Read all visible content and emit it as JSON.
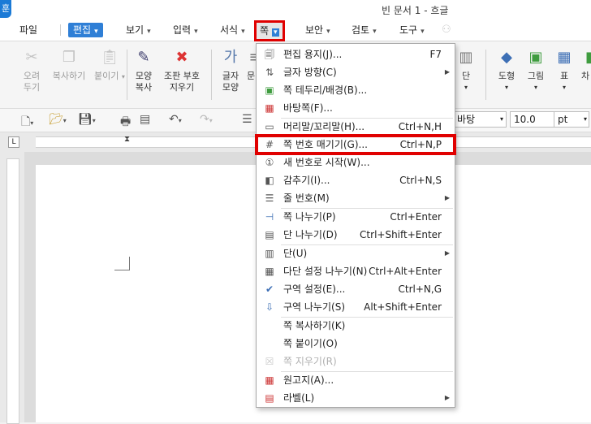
{
  "titlebar": {
    "logo": "훈",
    "title": "빈 문서 1 - 흐글"
  },
  "menubar": {
    "items": [
      {
        "label": "파일"
      },
      {
        "label": "편집"
      },
      {
        "label": "보기"
      },
      {
        "label": "입력"
      },
      {
        "label": "서식"
      },
      {
        "label": "쪽"
      },
      {
        "label": "보안"
      },
      {
        "label": "검토"
      },
      {
        "label": "도구"
      }
    ]
  },
  "ribbon": {
    "cut": "오려\n두기",
    "copy": "복사하기",
    "paste": "붙이기",
    "format_copy": "모양\n복사",
    "mark_remove": "조판 부호\n지우기",
    "char_shape": "글자\n모양",
    "para_shape": "문",
    "column": "단",
    "shape": "도형",
    "picture": "그림",
    "table": "표",
    "chart_partial": "차"
  },
  "toolbar2": {
    "style_name": "바탕",
    "font_size": "10.0",
    "unit": "pt"
  },
  "dropdown": {
    "items": [
      {
        "label": "편집 용지(J)...",
        "shortcut": "F7",
        "icon": "page-setup-icon",
        "submenu": false,
        "disabled": false
      },
      {
        "label": "글자 방향(C)",
        "shortcut": "",
        "icon": "text-direction-icon",
        "submenu": true,
        "disabled": false
      },
      {
        "label": "쪽 테두리/배경(B)...",
        "shortcut": "",
        "icon": "page-border-icon",
        "submenu": false,
        "disabled": false
      },
      {
        "label": "바탕쪽(F)...",
        "shortcut": "",
        "icon": "master-page-icon",
        "submenu": false,
        "disabled": false
      },
      {
        "label": "머리말/꼬리말(H)...",
        "shortcut": "Ctrl+N,H",
        "icon": "header-footer-icon",
        "submenu": false,
        "disabled": false
      },
      {
        "label": "쪽 번호 매기기(G)...",
        "shortcut": "Ctrl+N,P",
        "icon": "page-number-icon",
        "submenu": false,
        "disabled": false
      },
      {
        "label": "새 번호로 시작(W)...",
        "shortcut": "",
        "icon": "new-number-icon",
        "submenu": false,
        "disabled": false
      },
      {
        "label": "감추기(I)...",
        "shortcut": "Ctrl+N,S",
        "icon": "hide-icon",
        "submenu": false,
        "disabled": false
      },
      {
        "label": "줄 번호(M)",
        "shortcut": "",
        "icon": "line-number-icon",
        "submenu": true,
        "disabled": false
      },
      {
        "label": "쪽 나누기(P)",
        "shortcut": "Ctrl+Enter",
        "icon": "page-break-icon",
        "submenu": false,
        "disabled": false
      },
      {
        "label": "단 나누기(D)",
        "shortcut": "Ctrl+Shift+Enter",
        "icon": "column-break-icon",
        "submenu": false,
        "disabled": false
      },
      {
        "label": "단(U)",
        "shortcut": "",
        "icon": "column-icon",
        "submenu": true,
        "disabled": false
      },
      {
        "label": "다단 설정 나누기(N)",
        "shortcut": "Ctrl+Alt+Enter",
        "icon": "multi-column-icon",
        "submenu": false,
        "disabled": false
      },
      {
        "label": "구역 설정(E)...",
        "shortcut": "Ctrl+N,G",
        "icon": "section-setup-icon",
        "submenu": false,
        "disabled": false
      },
      {
        "label": "구역 나누기(S)",
        "shortcut": "Alt+Shift+Enter",
        "icon": "section-break-icon",
        "submenu": false,
        "disabled": false
      },
      {
        "label": "쪽 복사하기(K)",
        "shortcut": "",
        "icon": "",
        "submenu": false,
        "disabled": false
      },
      {
        "label": "쪽 붙이기(O)",
        "shortcut": "",
        "icon": "",
        "submenu": false,
        "disabled": false
      },
      {
        "label": "쪽 지우기(R)",
        "shortcut": "",
        "icon": "delete-page-icon",
        "submenu": false,
        "disabled": true
      },
      {
        "label": "원고지(A)...",
        "shortcut": "",
        "icon": "manuscript-icon",
        "submenu": false,
        "disabled": false
      },
      {
        "label": "라벨(L)",
        "shortcut": "",
        "icon": "label-icon",
        "submenu": true,
        "disabled": false
      }
    ]
  }
}
